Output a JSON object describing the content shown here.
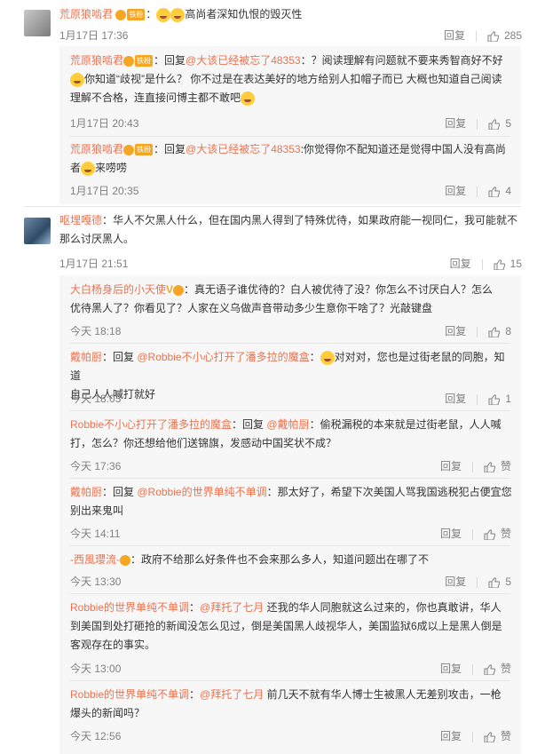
{
  "colors": {
    "name": "#eb7350",
    "text": "#333333",
    "meta": "#808080",
    "sub_bg": "#f7f7f7",
    "divider": "#e6e6e6"
  },
  "comments": [
    {
      "name": "荒原狼啮君",
      "badge": "铁粉",
      "text": "：",
      "text2": "高尚者深知仇恨的毁灭性",
      "time": "1月17日 17:36",
      "reply": "回复",
      "likes": "285"
    },
    {
      "name": "荒原狼啮君",
      "badge": "铁粉",
      "prefix": "：回复",
      "at": "@大该已经被忘了48353",
      "text": "：？阅读理解有问题就不要来秀智商好不好",
      "line2a": "你知道“歧视”是什么？ 你不过是在表达美好的地方给别人扣帽子而已 大概也知道自己阅读",
      "line3": "理解不合格，连直接问博主都不敢吧",
      "time": "1月17日 20:43",
      "reply": "回复",
      "likes": "5"
    },
    {
      "name": "荒原狼啮君",
      "badge": "铁粉",
      "prefix": "：回复",
      "at": "@大该已经被忘了48353",
      "text": ":你觉得你不配知道还是觉得中国人没有高尚",
      "line2": "者",
      "line2b": "来唠唠",
      "time": "1月17日 20:35",
      "reply": "回复",
      "likes": "4"
    },
    {
      "name": "呕埋嘎德",
      "text": "：华人不欠黑人什么，但在国内黑人得到了特殊优待，如果政府能一视同仁，我可能就不",
      "line2": "那么讨厌黑人。",
      "time": "1月17日 21:51",
      "reply": "回复",
      "likes": "15"
    },
    {
      "name": "大白杨身后的小天使",
      "text": "：真无语子谁优待的？白人被优待了没？你怎么不讨厌白人？怎么",
      "line2": "优待黑人了？你看见了？人家在义乌做声音带动多少生意你干啥了？光敲键盘",
      "time": "今天 18:18",
      "reply": "回复",
      "likes": "8"
    },
    {
      "name": "戴帕厨",
      "prefix": "：回复 ",
      "at": "@Robbie不小心打开了潘多拉的魔盒",
      "text": "：",
      "text2": "对对对，您也是过街老鼠的同胞，知道",
      "line2": "自己人人喊打就好",
      "time": "今天 18:03",
      "reply": "回复",
      "likes": "1"
    },
    {
      "name": "Robbie不小心打开了潘多拉的魔盒",
      "prefix": "：回复 ",
      "at": "@戴帕厨",
      "text": "：偷税漏税的本来就是过街老鼠，人人喊",
      "line2": "打，怎么？你还想给他们送锦旗，发感动中国奖状不成？",
      "time": "今天 17:36",
      "reply": "回复",
      "likes": "赞"
    },
    {
      "name": "戴帕厨",
      "prefix": "：回复 ",
      "at": "@Robbie的世界单纯不单调",
      "text": "：那太好了，希望下次美国人骂我国逃税犯占便宜您",
      "line2": "别出来鬼叫",
      "time": "今天 14:11",
      "reply": "回复",
      "likes": "赞"
    },
    {
      "name": "-西風瓔流-",
      "text": "：政府不给那么好条件也不会来那么多人，知道问题出在哪了不",
      "time": "今天 13:30",
      "reply": "回复",
      "likes": "5"
    },
    {
      "name": "Robbie的世界单纯不单调",
      "prefix": "：",
      "at": "@拜托了七月",
      "text": " 还我的华人同胞就这么过来的，你也真敢讲，华人",
      "line2": "到美国到处打砸抢的新闻没怎么见过，倒是美国黑人歧视华人，美国监狱6成以上是黑人倒是",
      "line3": "客观存在的事实。",
      "time": "今天 13:00",
      "reply": "回复",
      "likes": "赞"
    },
    {
      "name": "Robbie的世界单纯不单调",
      "prefix": "：",
      "at": "@拜托了七月",
      "text": " 前几天不就有华人博士生被黑人无差别攻击，一枪",
      "line2": "爆头的新闻吗？",
      "time": "今天 12:56",
      "reply": "回复",
      "likes": "赞"
    }
  ]
}
